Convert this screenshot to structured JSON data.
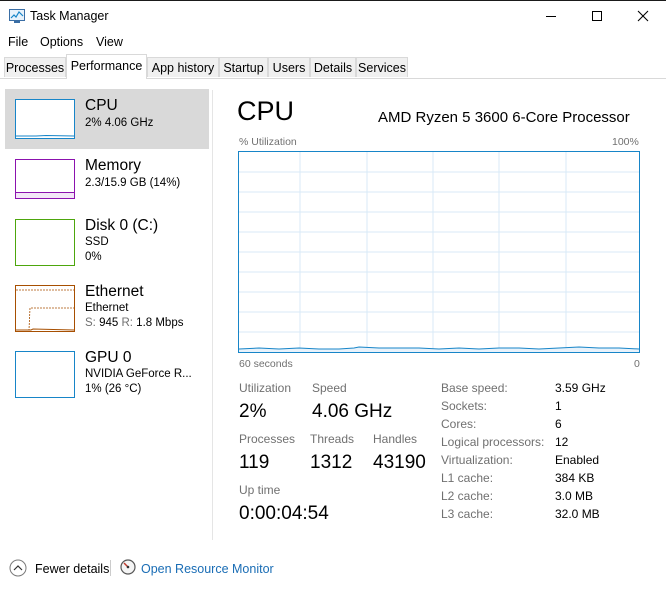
{
  "window": {
    "title": "Task Manager"
  },
  "menu": [
    "File",
    "Options",
    "View"
  ],
  "tabs": [
    "Processes",
    "Performance",
    "App history",
    "Startup",
    "Users",
    "Details",
    "Services"
  ],
  "active_tab": "Performance",
  "sidebar": {
    "items": [
      {
        "title": "CPU",
        "sub1": "2% 4.06 GHz",
        "color": "#1785c8"
      },
      {
        "title": "Memory",
        "sub1": "2.3/15.9 GB (14%)",
        "color": "#8b12ae"
      },
      {
        "title": "Disk 0 (C:)",
        "sub1": "SSD",
        "sub2": "0%",
        "color": "#4da60c"
      },
      {
        "title": "Ethernet",
        "sub1": "Ethernet",
        "sub2_s_label": "S:",
        "sub2_s_val": "945",
        "sub2_r_label": "R:",
        "sub2_r_val": "1.8 Mbps",
        "color": "#a74f01"
      },
      {
        "title": "GPU 0",
        "sub1": "NVIDIA GeForce R...",
        "sub2": "1% (26 °C)",
        "color": "#1785c8"
      }
    ]
  },
  "cpu": {
    "title": "CPU",
    "model": "AMD Ryzen 5 3600 6-Core Processor",
    "graph_label_left": "% Utilization",
    "graph_label_right": "100%",
    "graph_bottom_left": "60 seconds",
    "graph_bottom_right": "0",
    "utilization_label": "Utilization",
    "utilization_value": "2%",
    "speed_label": "Speed",
    "speed_value": "4.06 GHz",
    "processes_label": "Processes",
    "processes_value": "119",
    "threads_label": "Threads",
    "threads_value": "1312",
    "handles_label": "Handles",
    "handles_value": "43190",
    "uptime_label": "Up time",
    "uptime_value": "0:00:04:54",
    "specs": [
      {
        "label": "Base speed:",
        "value": "3.59 GHz"
      },
      {
        "label": "Sockets:",
        "value": "1"
      },
      {
        "label": "Cores:",
        "value": "6"
      },
      {
        "label": "Logical processors:",
        "value": "12"
      },
      {
        "label": "Virtualization:",
        "value": "Enabled"
      },
      {
        "label": "L1 cache:",
        "value": "384 KB"
      },
      {
        "label": "L2 cache:",
        "value": "3.0 MB"
      },
      {
        "label": "L3 cache:",
        "value": "32.0 MB"
      }
    ]
  },
  "footer": {
    "fewer_details": "Fewer details",
    "resource_monitor": "Open Resource Monitor"
  }
}
